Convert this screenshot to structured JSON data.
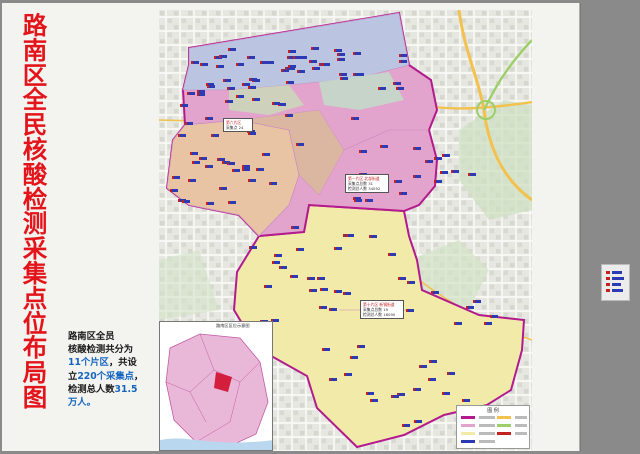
{
  "title": [
    "路",
    "南",
    "区",
    "全",
    "民",
    "核",
    "酸",
    "检",
    "测",
    "采",
    "集",
    "点",
    "位",
    "布",
    "局",
    "图"
  ],
  "summary": {
    "line1": "路南区全员",
    "line2": "核酸检测共分为",
    "line3a": "11个片区",
    "line3b": "，共设",
    "line4a": "立",
    "line4b": "220个采集点",
    "line4c": "，",
    "line5a": "检测总人数",
    "line5b": "31.5",
    "line6": "万人。"
  },
  "map": {
    "inset_title": "路南区区位示意图",
    "legend_title": "图  例",
    "central_label": {
      "line1": "第一片区 北部街道",
      "line2": "采集点总数 31",
      "line3": "检测总人数 34092"
    },
    "south_label": {
      "line1": "第十片区 新钢街道",
      "line2": "采集点总数 19",
      "line3": "检测总人数 16090"
    },
    "west_label": {
      "line1": "第六片区",
      "line2": "采集点 24"
    }
  },
  "colors": {
    "title_red": "#e3151b",
    "number_blue": "#1565c0",
    "boundary_magenta": "#b21a8d",
    "north_zone": "#e2a4cc",
    "south_zone": "#f2eaa9",
    "west_zone": "#e8c4a5",
    "pin_blue": "#2c3bb4",
    "pin_red": "#c32020"
  },
  "icons": {
    "pin": "collection-point-icon",
    "flag": "red-flag-icon"
  }
}
